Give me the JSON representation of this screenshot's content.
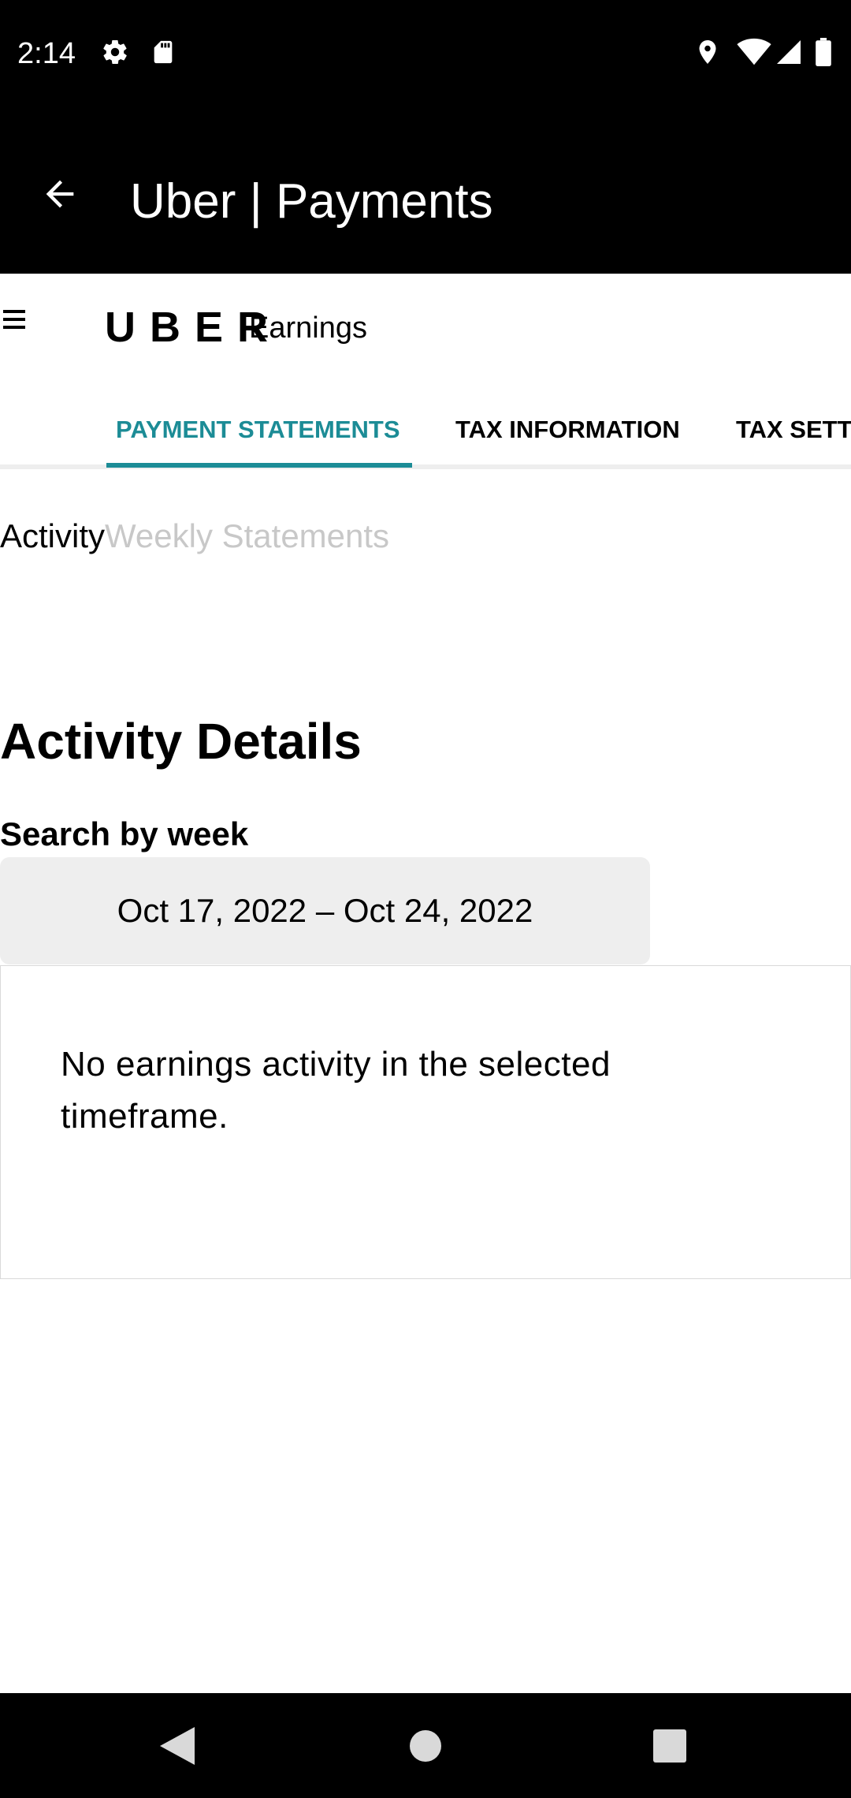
{
  "status_bar": {
    "time": "2:14",
    "icons": [
      "settings-icon",
      "sd-card-icon",
      "location-icon",
      "wifi-icon",
      "cell-signal-icon",
      "battery-icon"
    ]
  },
  "app_bar": {
    "title": "Uber | Payments",
    "back_icon": "arrow-left-icon"
  },
  "header": {
    "logo": "UBER",
    "product": "Earnings",
    "menu_icon": "hamburger-menu-icon"
  },
  "tabs": [
    {
      "label": "PAYMENT STATEMENTS",
      "active": true
    },
    {
      "label": "TAX INFORMATION",
      "active": false
    },
    {
      "label": "TAX SETT",
      "active": false
    }
  ],
  "sub_tabs": [
    {
      "label": "Activity",
      "active": true
    },
    {
      "label": "Weekly Statements",
      "active": false
    }
  ],
  "activity": {
    "title": "Activity Details",
    "search_label": "Search by week",
    "date_range": "Oct 17, 2022 – Oct 24, 2022",
    "empty_message": "No earnings activity in the selected timeframe."
  },
  "colors": {
    "accent": "#1c8c96",
    "bar_background": "#000000",
    "picker_background": "#eeeeee",
    "inactive_subtab": "#c8c8c8"
  },
  "nav_bar": {
    "icons": [
      "back-triangle-icon",
      "home-circle-icon",
      "recents-square-icon"
    ]
  }
}
